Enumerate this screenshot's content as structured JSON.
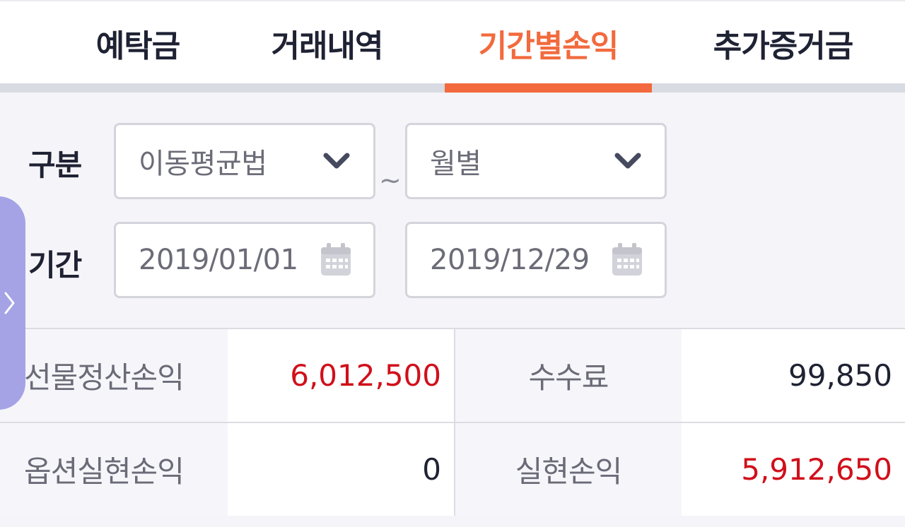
{
  "tabs": [
    {
      "label": "예탁금",
      "active": false
    },
    {
      "label": "거래내역",
      "active": false
    },
    {
      "label": "기간별손익",
      "active": true
    },
    {
      "label": "추가증거금",
      "active": false
    }
  ],
  "filters": {
    "category_label": "구분",
    "method_value": "이동평균법",
    "unit_value": "월별",
    "period_label": "기간",
    "start_date": "2019/01/01",
    "separator": "~",
    "end_date": "2019/12/29"
  },
  "summary": {
    "futures_pl_label": "선물정산손익",
    "futures_pl_value": "6,012,500",
    "fee_label": "수수료",
    "fee_value": "99,850",
    "options_pl_label": "옵션실현손익",
    "options_pl_value": "0",
    "realized_pl_label": "실현손익",
    "realized_pl_value": "5,912,650"
  },
  "colors": {
    "accent": "#f26a3d",
    "profit": "#d0101b",
    "side_handle": "#a5a3e6"
  },
  "icons": {
    "dropdown": "chevron-down-icon",
    "date": "calendar-icon",
    "side": "chevron-right-icon"
  }
}
